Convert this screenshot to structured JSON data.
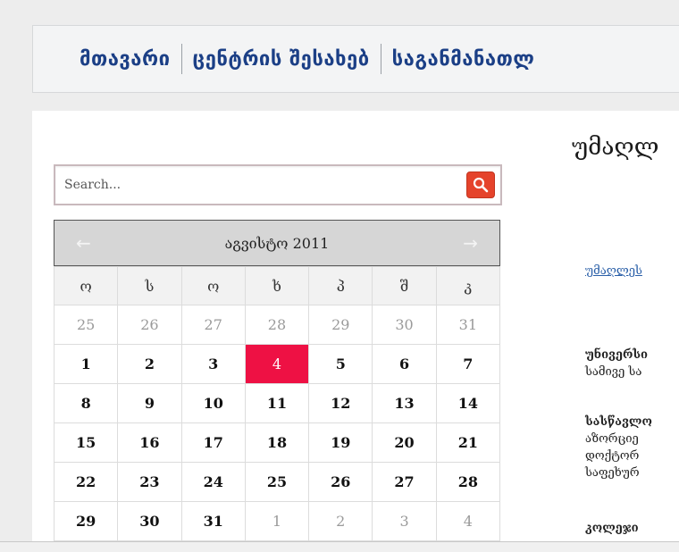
{
  "nav": {
    "items": [
      "მთავარი",
      "ცენტრის შესახებ",
      "საგანმანათლ"
    ]
  },
  "search": {
    "placeholder": "Search..."
  },
  "calendar": {
    "prev_arrow": "←",
    "next_arrow": "→",
    "title": "აგვისტო 2011",
    "weekdays": [
      "ო",
      "ს",
      "ო",
      "ხ",
      "პ",
      "შ",
      "კ"
    ],
    "weeks": [
      [
        {
          "d": "25",
          "m": true
        },
        {
          "d": "26",
          "m": true
        },
        {
          "d": "27",
          "m": true
        },
        {
          "d": "28",
          "m": true
        },
        {
          "d": "29",
          "m": true
        },
        {
          "d": "30",
          "m": true
        },
        {
          "d": "31",
          "m": true
        }
      ],
      [
        {
          "d": "1"
        },
        {
          "d": "2"
        },
        {
          "d": "3"
        },
        {
          "d": "4",
          "today": true
        },
        {
          "d": "5"
        },
        {
          "d": "6"
        },
        {
          "d": "7"
        }
      ],
      [
        {
          "d": "8"
        },
        {
          "d": "9"
        },
        {
          "d": "10"
        },
        {
          "d": "11"
        },
        {
          "d": "12"
        },
        {
          "d": "13"
        },
        {
          "d": "14"
        }
      ],
      [
        {
          "d": "15"
        },
        {
          "d": "16"
        },
        {
          "d": "17"
        },
        {
          "d": "18"
        },
        {
          "d": "19"
        },
        {
          "d": "20"
        },
        {
          "d": "21"
        }
      ],
      [
        {
          "d": "22"
        },
        {
          "d": "23"
        },
        {
          "d": "24"
        },
        {
          "d": "25"
        },
        {
          "d": "26"
        },
        {
          "d": "27"
        },
        {
          "d": "28"
        }
      ],
      [
        {
          "d": "29"
        },
        {
          "d": "30"
        },
        {
          "d": "31"
        },
        {
          "d": "1",
          "m": true
        },
        {
          "d": "2",
          "m": true
        },
        {
          "d": "3",
          "m": true
        },
        {
          "d": "4",
          "m": true
        }
      ]
    ],
    "today_color": "#ee1144"
  },
  "main": {
    "heading": "უმაღლ",
    "link": "უმაღლეს",
    "paragraphs": [
      {
        "title": "უნივერსი",
        "lines": [
          "სამივე სა"
        ]
      },
      {
        "title": "სასწავლო",
        "lines": [
          "აზორციე",
          "დოქტორ",
          "საფეხურ"
        ]
      },
      {
        "title": "კოლეჯი",
        "lines": []
      }
    ]
  }
}
